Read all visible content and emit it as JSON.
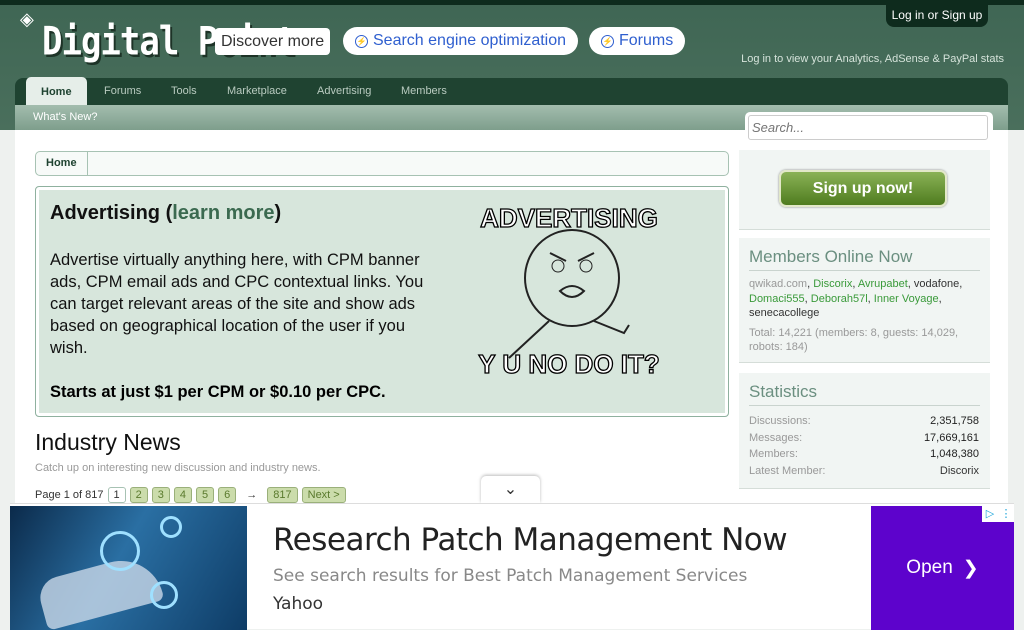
{
  "header": {
    "logo": "Digital Point",
    "discover": "Discover more",
    "pills": [
      "Search engine optimization",
      "Forums"
    ],
    "login": "Log in or Sign up",
    "stats_link": "Log in to view your Analytics, AdSense & PayPal stats"
  },
  "nav": {
    "tabs": [
      "Home",
      "Forums",
      "Tools",
      "Marketplace",
      "Advertising",
      "Members"
    ],
    "sub": "What's New?"
  },
  "breadcrumb": "Home",
  "advert": {
    "title_pre": "Advertising (",
    "title_link": "learn more",
    "title_post": ")",
    "body": "Advertise virtually anything here, with CPM banner ads, CPM email ads and CPC contextual links. You can target relevant areas of the site and show ads based on geographical location of the user if you wish.",
    "price": "Starts at just $1 per CPM or $0.10 per CPC.",
    "meme_top": "ADVERTISING",
    "meme_bottom": "Y U NO DO IT?"
  },
  "news": {
    "title": "Industry News",
    "subtitle": "Catch up on interesting new discussion and industry news.",
    "page_label": "Page 1 of 817",
    "pages": [
      "1",
      "2",
      "3",
      "4",
      "5",
      "6"
    ],
    "arrow": "→",
    "last": "817",
    "next": "Next >"
  },
  "sidebar": {
    "search_placeholder": "Search...",
    "signup": "Sign up now!",
    "online": {
      "title": "Members Online Now",
      "members": [
        {
          "name": "qwikad.com",
          "style": "q"
        },
        {
          "name": "Discorix",
          "style": "g"
        },
        {
          "name": "Avrupabet",
          "style": "g"
        },
        {
          "name": "vodafone",
          "style": ""
        },
        {
          "name": "Domaci555",
          "style": "g"
        },
        {
          "name": "Deborah57l",
          "style": "g"
        },
        {
          "name": "Inner Voyage",
          "style": "g"
        },
        {
          "name": "senecacollege",
          "style": ""
        }
      ],
      "total": "Total: 14,221 (members: 8, guests: 14,029, robots: 184)"
    },
    "stats": {
      "title": "Statistics",
      "rows": [
        {
          "k": "Discussions:",
          "v": "2,351,758"
        },
        {
          "k": "Messages:",
          "v": "17,669,161"
        },
        {
          "k": "Members:",
          "v": "1,048,380"
        },
        {
          "k": "Latest Member:",
          "v": "Discorix"
        }
      ]
    }
  },
  "banner": {
    "title": "Research Patch Management Now",
    "subtitle": "See search results for Best Patch Management Services",
    "source": "Yahoo",
    "cta": "Open"
  }
}
